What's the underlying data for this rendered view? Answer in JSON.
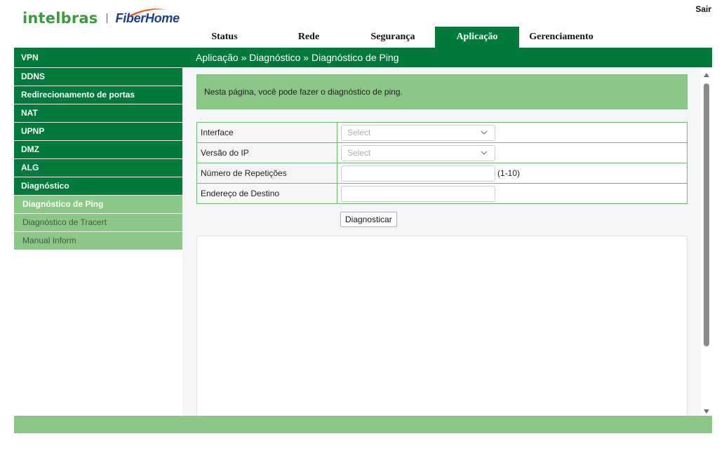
{
  "header": {
    "logo_left": "intelbras",
    "logo_right": "FiberHome",
    "logout": "Sair"
  },
  "nav": {
    "tabs": [
      {
        "label": "Status",
        "active": false
      },
      {
        "label": "Rede",
        "active": false
      },
      {
        "label": "Segurança",
        "active": false
      },
      {
        "label": "Aplicação",
        "active": true
      },
      {
        "label": "Gerenciamento",
        "active": false
      }
    ]
  },
  "sidebar": {
    "items": [
      {
        "label": "VPN"
      },
      {
        "label": "DDNS"
      },
      {
        "label": "Redirecionamento de portas"
      },
      {
        "label": "NAT"
      },
      {
        "label": "UPNP"
      },
      {
        "label": "DMZ"
      },
      {
        "label": "ALG"
      },
      {
        "label": "Diagnóstico"
      }
    ],
    "subitems": [
      {
        "label": "Diagnóstico de Ping",
        "active": true
      },
      {
        "label": "Diagnóstico de Tracert",
        "active": false
      },
      {
        "label": "Manual Inform",
        "active": false
      }
    ]
  },
  "page": {
    "breadcrumb": "Aplicação » Diagnóstico » Diagnóstico de Ping",
    "info": "Nesta página, você pode fazer o diagnóstico de ping."
  },
  "form": {
    "interface_label": "Interface",
    "interface_value": "Select",
    "ip_version_label": "Versão do IP",
    "ip_version_value": "Select",
    "repetitions_label": "Número de Repetições",
    "repetitions_value": "",
    "repetitions_hint": "(1-10)",
    "destination_label": "Endereço de Destino",
    "destination_value": "",
    "submit_label": "Diagnosticar"
  },
  "colors": {
    "primary_green": "#027a3c",
    "light_green": "#8bc786",
    "logo_green": "#3a9b3e",
    "logo_blue": "#1b3f8f",
    "swoosh_orange": "#e8581c"
  },
  "icons": {
    "select_arrow": "chevron-down-icon",
    "scroll_up": "arrow-up-icon",
    "scroll_down": "arrow-down-icon"
  }
}
